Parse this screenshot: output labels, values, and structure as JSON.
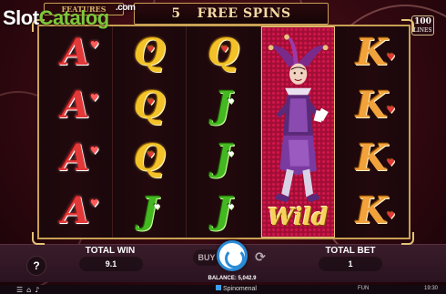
{
  "watermark": {
    "part1": "Slot",
    "part2": "Catalog",
    "suffix": ".com"
  },
  "header": {
    "features_label": "FEATURES",
    "free_spins_count": "5",
    "free_spins_label": "FREE SPINS",
    "lines_value": "100",
    "lines_label": "LINES"
  },
  "reels": [
    {
      "symbols": [
        "A",
        "A",
        "A",
        "A"
      ]
    },
    {
      "symbols": [
        "Q",
        "Q",
        "Q",
        "J"
      ]
    },
    {
      "symbols": [
        "Q",
        "J",
        "J",
        "J"
      ]
    },
    {
      "wild_label": "Wild"
    },
    {
      "symbols": [
        "K",
        "K",
        "K",
        "K"
      ]
    }
  ],
  "bottom": {
    "help_label": "?",
    "total_win_label": "TOTAL WIN",
    "total_win_value": "9.1",
    "buy_label": "BUY",
    "total_bet_label": "TOTAL BET",
    "total_bet_value": "1",
    "balance_text": "BALANCE: 5,042.9"
  },
  "footer": {
    "provider": "Spinomenal",
    "mode": "FUN",
    "time": "19:30"
  },
  "colors": {
    "reel_frame": "#c9a054",
    "wild_background": "#9a0e33",
    "spin_accent": "#2a8bd6"
  },
  "icons": [
    "help-icon",
    "spin-icon",
    "autoplay-icon",
    "menu-icon",
    "home-icon",
    "sound-icon"
  ]
}
